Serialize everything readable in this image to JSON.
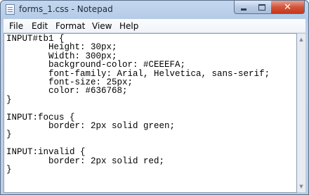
{
  "window": {
    "title": "forms_1.css - Notepad",
    "controls": {
      "minimize": "",
      "maximize": "",
      "close": "✕"
    }
  },
  "menu": {
    "items": [
      "File",
      "Edit",
      "Format",
      "View",
      "Help"
    ]
  },
  "editor": {
    "content": "INPUT#tb1 {\n\tHeight: 30px;\n\tWidth: 300px;\n\tbackground-color: #CEEEFA;\n\tfont-family: Arial, Helvetica, sans-serif;\n\tfont-size: 25px;\n\tcolor: #636768;\n}\n\nINPUT:focus {\n\tborder: 2px solid green;\n}\n\nINPUT:invalid {\n\tborder: 2px solid red;\n}"
  },
  "scrollbar": {
    "up_arrow": "▲",
    "down_arrow": "▼"
  },
  "colors": {
    "titlebar": "#bcd0e9",
    "close_button": "#c2381d",
    "editor_bg": "#ffffff"
  }
}
